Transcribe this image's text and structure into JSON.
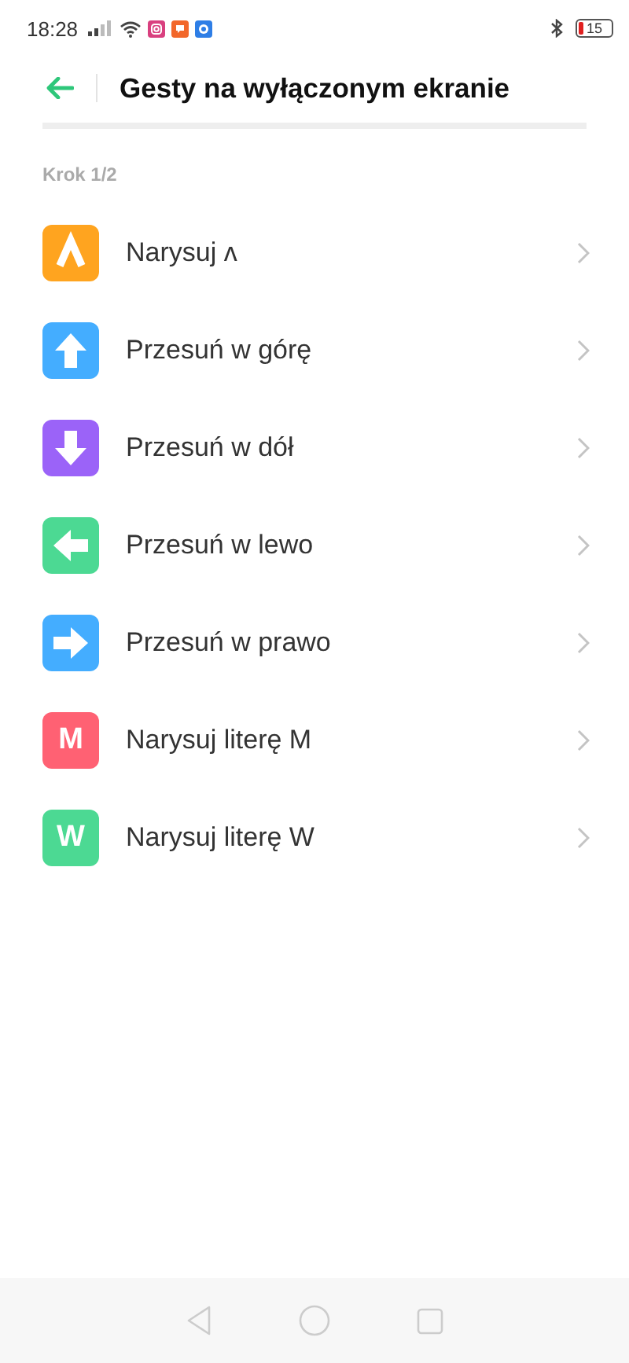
{
  "status_bar": {
    "time": "18:28",
    "battery": "15"
  },
  "header": {
    "title": "Gesty na wyłączonym ekranie"
  },
  "step": "Krok 1/2",
  "items": [
    {
      "label": "Narysuj ʌ",
      "kind": "caret",
      "color": "#ffa41f"
    },
    {
      "label": "Przesuń w górę",
      "kind": "up",
      "color": "#44adff"
    },
    {
      "label": "Przesuń w dół",
      "kind": "down",
      "color": "#9b63f8"
    },
    {
      "label": "Przesuń w lewo",
      "kind": "left",
      "color": "#4cd993"
    },
    {
      "label": "Przesuń w prawo",
      "kind": "right",
      "color": "#44adff"
    },
    {
      "label": "Narysuj literę M",
      "kind": "letter",
      "letter": "M",
      "color": "#ff6173"
    },
    {
      "label": "Narysuj literę W",
      "kind": "letter",
      "letter": "W",
      "color": "#4cd993"
    }
  ]
}
